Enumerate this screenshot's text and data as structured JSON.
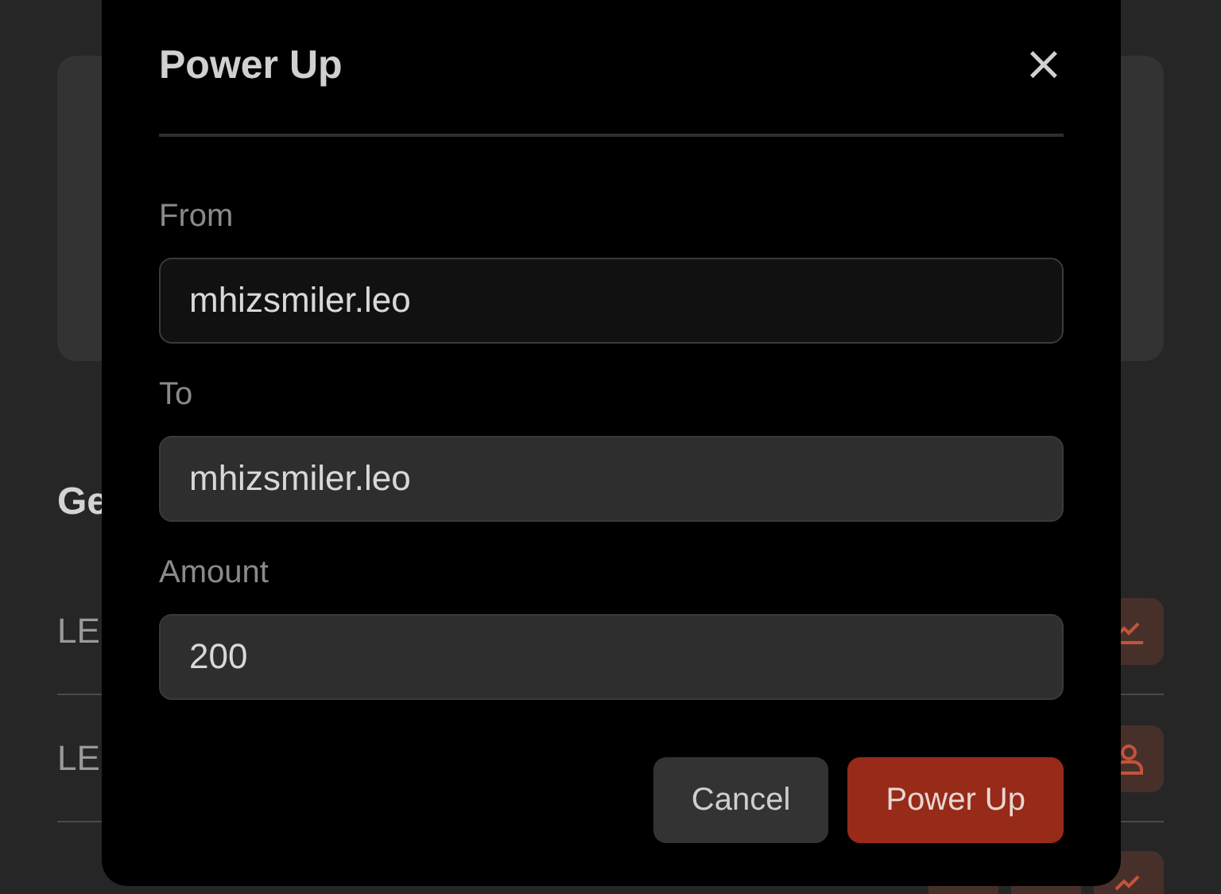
{
  "page": {
    "section_title": "Ge",
    "rows": [
      {
        "label": "LE",
        "actions": [
          {
            "kind": "chart"
          }
        ]
      },
      {
        "label": "LE",
        "actions": [
          {
            "kind": "user"
          }
        ]
      },
      {
        "actions": [
          {
            "kind": "blank"
          },
          {
            "kind": "blank"
          },
          {
            "kind": "chart"
          }
        ]
      }
    ]
  },
  "dialog": {
    "title": "Power Up",
    "close": "×",
    "fields": [
      {
        "label": "From",
        "value": "mhizsmiler.leo",
        "readonly": true
      },
      {
        "label": "To",
        "value": "mhizsmiler.leo",
        "readonly": false
      },
      {
        "label": "Amount",
        "value": "200",
        "readonly": false
      }
    ],
    "buttons": [
      {
        "label": "Cancel",
        "kind": "secondary"
      },
      {
        "label": "Power Up",
        "kind": "primary"
      }
    ]
  }
}
